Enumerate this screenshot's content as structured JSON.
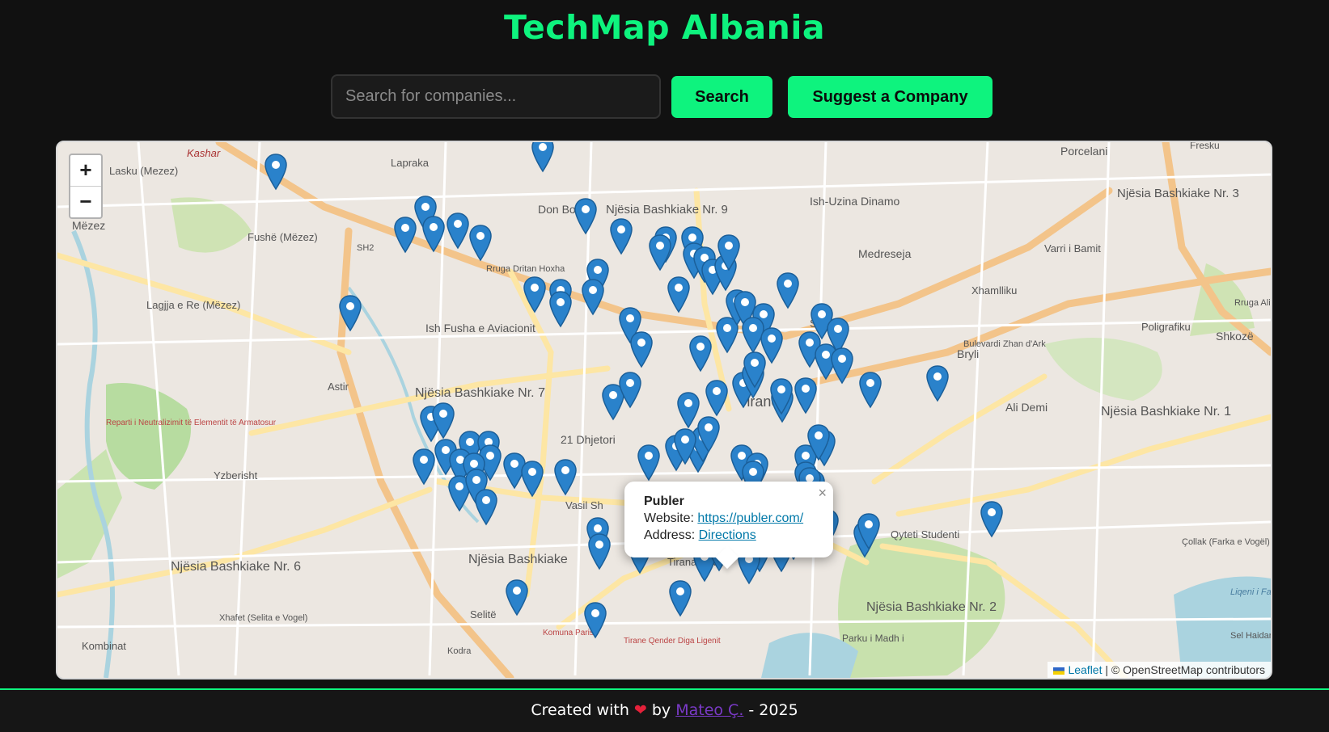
{
  "header": {
    "title": "TechMap Albania"
  },
  "search": {
    "placeholder": "Search for companies...",
    "button_label": "Search"
  },
  "suggest": {
    "button_label": "Suggest a Company"
  },
  "map": {
    "zoom_in": "+",
    "zoom_out": "−",
    "labels": [
      "Kashar",
      "Lasku (Mezez)",
      "Lapraka",
      "Mëzez",
      "Fushë (Mëzez)",
      "SH2",
      "Don Bosko",
      "Njësia Bashkiake Nr. 9",
      "Ish-Uzina Dinamo",
      "Porcelani",
      "Njësia Bashkiake Nr. 3",
      "Varri i Bamit",
      "Medreseja",
      "Xhamlliku",
      "Lagjja e Re (Mëzez)",
      "Ish Fusha e Aviacionit",
      "Rruga Dritan Hoxha",
      "Rruga Ali Shi",
      "Poligrafiku",
      "Shkozë",
      "Selvia",
      "Bulevardi Zhan d'Ark",
      "Bryli",
      "Astir",
      "Njësia Bashkiake Nr. 7",
      "Tiranë",
      "Ali Demi",
      "Njësia Bashkiake Nr. 1",
      "21 Dhjetori",
      "Reparti i Neutralizimit të Elementit të Armatosur",
      "Yzberisht",
      "Njësia Bashkiake Nr. 6",
      "Njësia Bashkiake",
      "Selitë",
      "Xhafet (Selita e Vogel)",
      "Kombinat",
      "Qyteti Studenti",
      "Çollak (Farka e Vogël)",
      "Njësia Bashkiake Nr. 2",
      "Parku i Madh i",
      "Liqeni i Farkës",
      "Kodra",
      "Fresku",
      "Vasil Sh",
      "Tirana e R",
      "Sel Haidarit",
      "Komuna Parisit",
      "Tirane Qender Diga Ligenit"
    ],
    "attribution": {
      "leaflet": "Leaflet",
      "osm": " | © OpenStreetMap contributors"
    }
  },
  "popup": {
    "name": "Publer",
    "website_label": "Website: ",
    "website_url": "https://publer.com/",
    "address_label": "Address: ",
    "directions": "Directions",
    "close": "×"
  },
  "footer": {
    "prefix": "Created with ",
    "heart": "❤",
    "by": " by ",
    "author": "Mateo Ç.",
    "year": " - 2025"
  }
}
